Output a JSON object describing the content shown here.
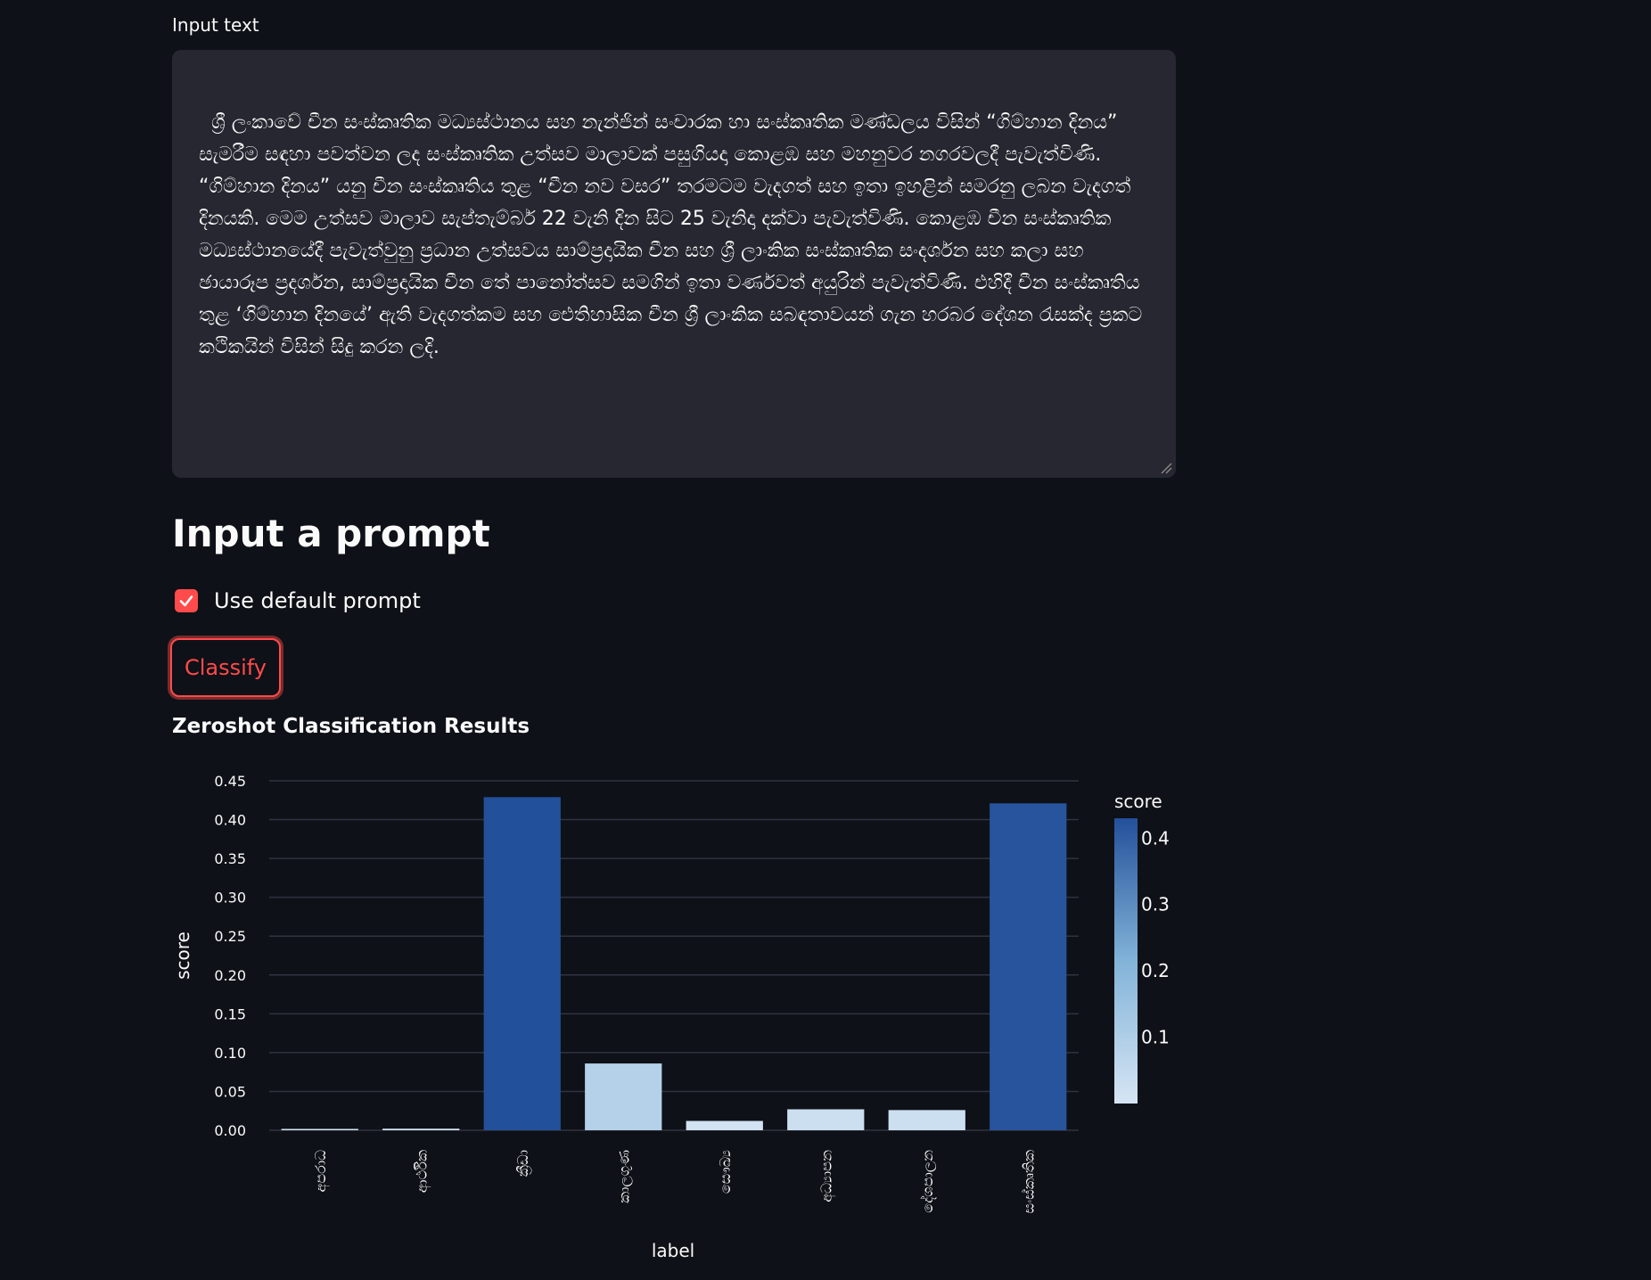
{
  "input": {
    "label": "Input text",
    "value": "ශ්‍රී ලංකාවේ චීන සංස්කෘතික මධ්‍යස්ථානය සහ නැන්ජින් සංචාරක හා සංස්කෘතික මණ්ඩලය විසින් “ගිම්හාන දිනය” සැමරීම සඳහා පවත්වන ලද සංස්කෘතික උත්සව මාලාවක් පසුගියදා කොළඹ සහ මහනුවර නගරවලදී පැවැත්විණි. “ගිම්හාන දිනය” යනු චීන සංස්කෘතිය තුළ “චීන නව වසර” තරමටම වැදගත් සහ ඉතා ඉහළින් සමරනු ලබන වැදගත් දිනයකි. මෙම උත්සව මාලාව සැප්තැම්බර් 22 වැනි දින සිට 25 වැනිදා දක්වා පැවැත්විණි. කොළඹ චීන සංස්කෘතික මධ්‍යස්ථානයේදී පැවැත්වුනු ප්‍රධාන උත්සවය සාම්ප්‍රදායික චීන සහ ශ්‍රී ලාංකික සංස්කෘතික සංදර්ශන සහ කලා සහ ඡායාරූප ප්‍රදර්ශන, සාම්ප්‍රදායික චීන තේ පානෝත්සව සමගින් ඉතා වර්ණවත් අයුරින් පැවැත්විණි. එහිදී චීන සංස්කෘතිය තුළ ‘ගිම්හාන දිනයේ’ ඇති වැදගත්කම සහ ඓතිහාසික චීන ශ්‍රී ලාංකික සබඳතාවයන් ගැන හරබර දේශන රැසක්ද ප්‍රකට කථිකයින් විසින් සිදු කරන ලදි."
  },
  "prompt": {
    "heading": "Input a prompt",
    "checkbox_label": "Use default prompt",
    "checkbox_checked": true
  },
  "classify_button": "Classify",
  "results_title": "Zeroshot Classification Results",
  "colors": {
    "accent": "#ff4b4b",
    "background": "#0e1117",
    "textarea": "#262730",
    "scale_low": "#d6e5f4",
    "scale_high": "#23509a"
  },
  "chart_data": {
    "type": "bar",
    "categories": [
      "අපරාධ",
      "ආර්ථික",
      "ක්‍රීඩා",
      "කාලගුණ",
      "සෞඛ්‍ය",
      "අධ්‍යාපන",
      "දේශපාලන",
      "සංස්කෘතික"
    ],
    "values": [
      0.001,
      0.002,
      0.429,
      0.086,
      0.012,
      0.027,
      0.026,
      0.421
    ],
    "xlabel": "label",
    "ylabel": "score",
    "ylim": [
      0,
      0.45
    ],
    "yticks": [
      "0.00",
      "0.05",
      "0.10",
      "0.15",
      "0.20",
      "0.25",
      "0.30",
      "0.35",
      "0.40",
      "0.45"
    ],
    "colorbar": {
      "title": "score",
      "ticks": [
        "0.1",
        "0.2",
        "0.3",
        "0.4"
      ]
    },
    "grid": true
  }
}
